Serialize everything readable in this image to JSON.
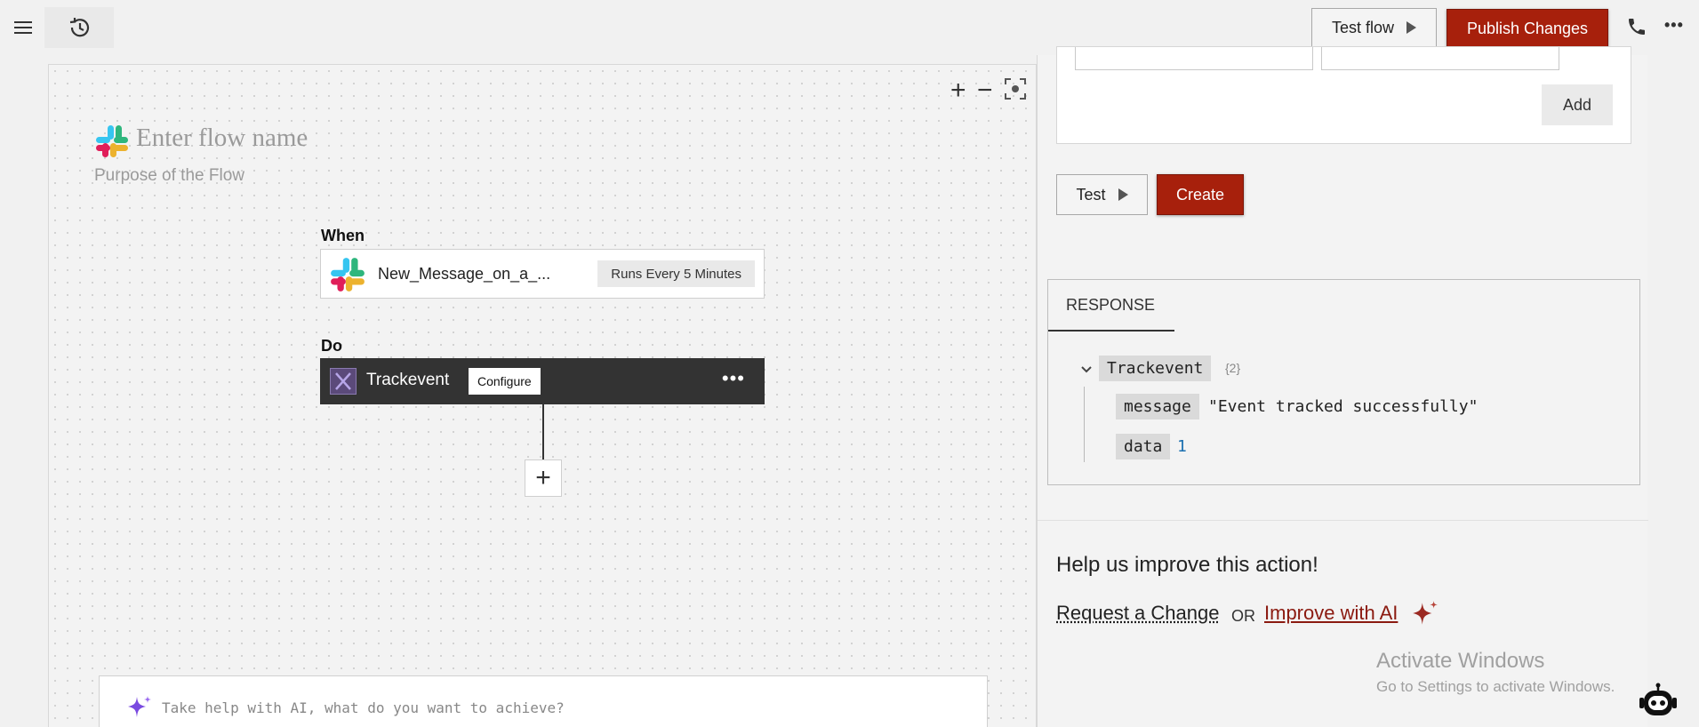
{
  "toolbar": {
    "test_flow_label": "Test flow",
    "publish_label": "Publish Changes",
    "more_label": "•••",
    "accent_color": "#a7200c"
  },
  "canvas": {
    "zoom_in": "+",
    "zoom_out": "−",
    "flow_name_placeholder": "Enter flow name",
    "flow_purpose_placeholder": "Purpose of the Flow",
    "when_label": "When",
    "trigger": {
      "name": "New_Message_on_a_...",
      "schedule": "Runs Every 5 Minutes",
      "icon": "slack-icon"
    },
    "do_label": "Do",
    "action": {
      "name": "Trackevent",
      "configure_label": "Configure",
      "more_label": "•••",
      "icon": "trackevent-icon"
    },
    "add_step_label": "+",
    "ai_placeholder": "Take help with AI, what do you want to achieve?"
  },
  "panel": {
    "add_label": "Add",
    "test_label": "Test",
    "create_label": "Create",
    "response_tab": "RESPONSE",
    "response": {
      "root_key": "Trackevent",
      "root_count": "{2}",
      "entries": [
        {
          "key": "message",
          "value": "\"Event tracked successfully\""
        },
        {
          "key": "data",
          "value": "1"
        }
      ]
    },
    "help_title": "Help us improve this action!",
    "request_change_label": "Request a Change",
    "or_label": "OR",
    "improve_ai_label": "Improve with AI"
  },
  "watermark": {
    "line1": "Activate Windows",
    "line2": "Go to Settings to activate Windows."
  }
}
